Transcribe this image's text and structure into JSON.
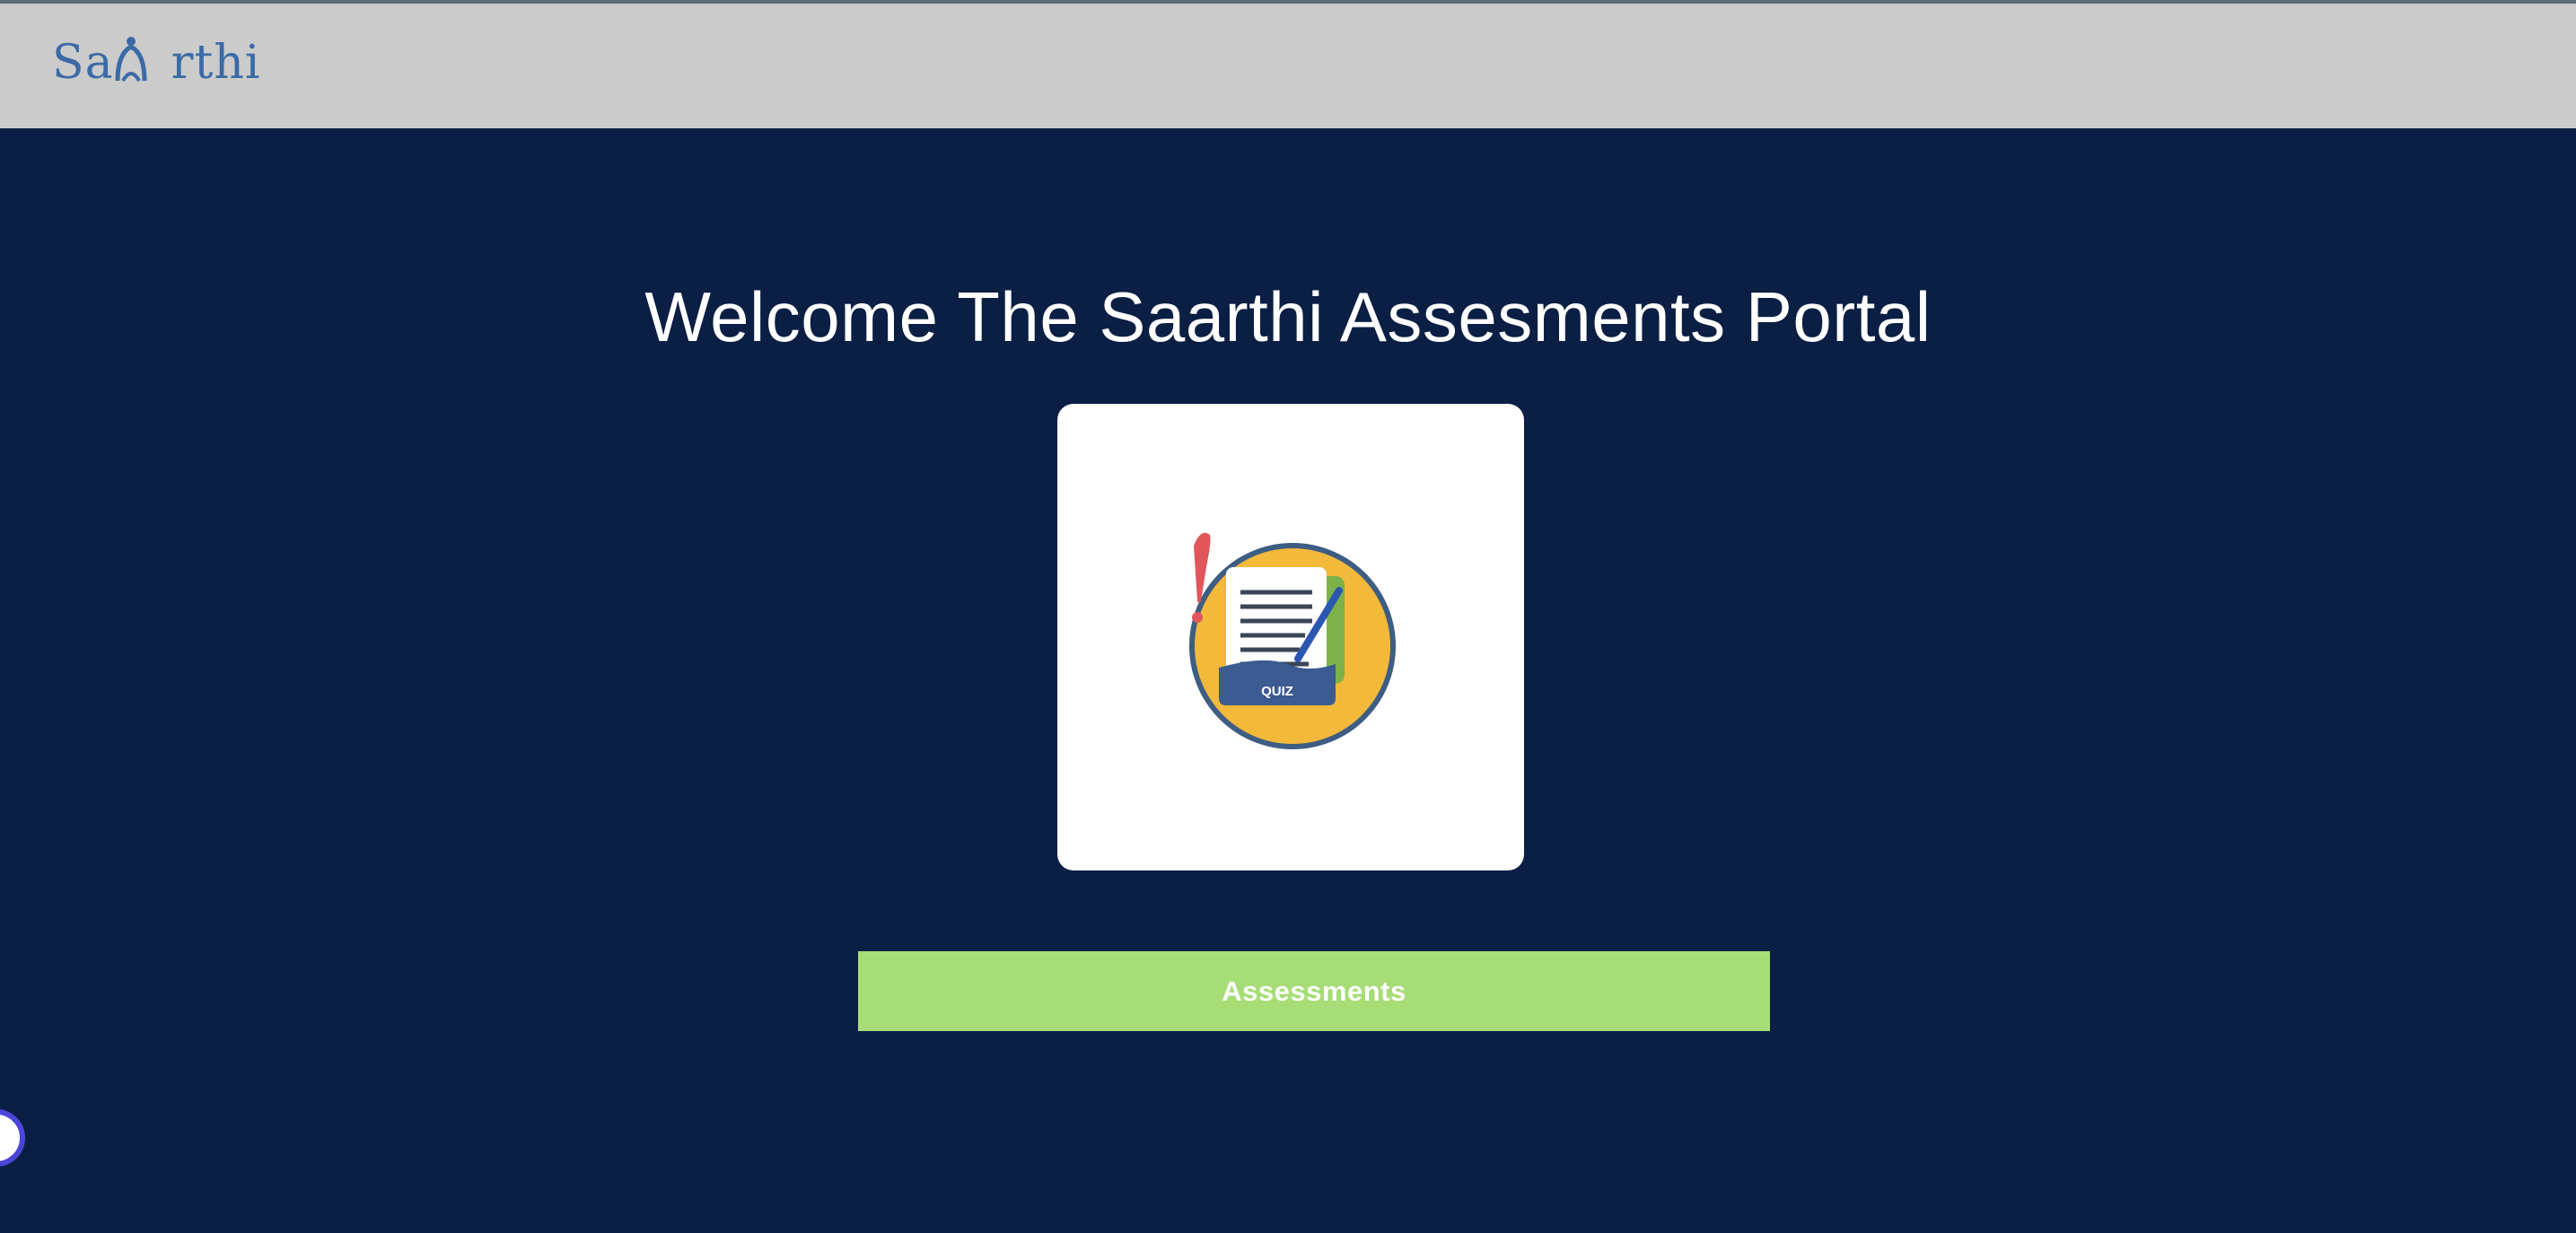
{
  "header": {
    "logo_text_left": "Sa",
    "logo_text_right": "rthi"
  },
  "main": {
    "title": "Welcome The Saarthi Assesments Portal",
    "illustration": {
      "icon": "quiz-document-icon",
      "badge_text": "QUIZ"
    },
    "cta_label": "Assessments"
  },
  "colors": {
    "header_bg": "#cbcbcb",
    "page_bg": "#0b1f44",
    "logo": "#3b6aa6",
    "cta_bg": "#a6dd76",
    "quiz_circle": "#f3b93b",
    "quiz_band": "#3b5b92",
    "alert": "#e0565b"
  }
}
